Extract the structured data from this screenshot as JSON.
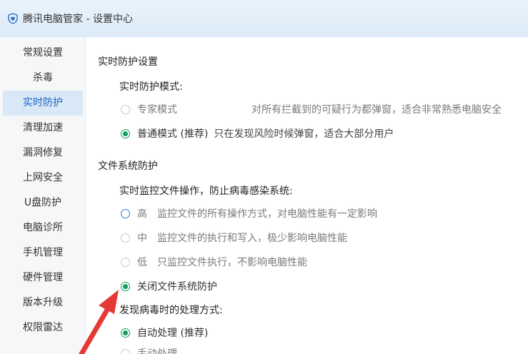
{
  "window": {
    "title": "腾讯电脑管家 - 设置中心",
    "logo_icon": "shield-heart-icon",
    "accent_color": "#1a64c5"
  },
  "sidebar": {
    "items": [
      {
        "label": "常规设置",
        "active": false
      },
      {
        "label": "杀毒",
        "active": false
      },
      {
        "label": "实时防护",
        "active": true
      },
      {
        "label": "清理加速",
        "active": false
      },
      {
        "label": "漏洞修复",
        "active": false
      },
      {
        "label": "上网安全",
        "active": false
      },
      {
        "label": "U盘防护",
        "active": false
      },
      {
        "label": "电脑诊所",
        "active": false
      },
      {
        "label": "手机管理",
        "active": false
      },
      {
        "label": "硬件管理",
        "active": false
      },
      {
        "label": "版本升级",
        "active": false
      },
      {
        "label": "权限雷达",
        "active": false
      }
    ]
  },
  "realtime": {
    "section_title": "实时防护设置",
    "mode_label": "实时防护模式:",
    "options": [
      {
        "label": "专家模式",
        "desc": "对所有拦截到的可疑行为都弹窗，适合非常熟悉电脑安全",
        "checked": false
      },
      {
        "label": "普通模式 (推荐)",
        "desc": "只在发现风险时候弹窗，适合大部分用户",
        "checked": true
      }
    ]
  },
  "filesystem": {
    "section_title": "文件系统防护",
    "monitor_label": "实时监控文件操作，防止病毒感染系统:",
    "options": [
      {
        "label": "高",
        "desc": "监控文件的所有操作方式，对电脑性能有一定影响",
        "checked": false
      },
      {
        "label": "中",
        "desc": "监控文件的执行和写入，极少影响电脑性能",
        "checked": false
      },
      {
        "label": "低",
        "desc": "只监控文件执行，不影响电脑性能",
        "checked": false
      },
      {
        "label": "关闭文件系统防护",
        "desc": "",
        "checked": true
      }
    ],
    "virus_label": "发现病毒时的处理方式:",
    "virus_options": [
      {
        "label": "自动处理 (推荐)",
        "checked": true
      },
      {
        "label": "手动处理",
        "checked": false
      }
    ]
  },
  "annotation": {
    "arrow_color": "#e53935"
  }
}
